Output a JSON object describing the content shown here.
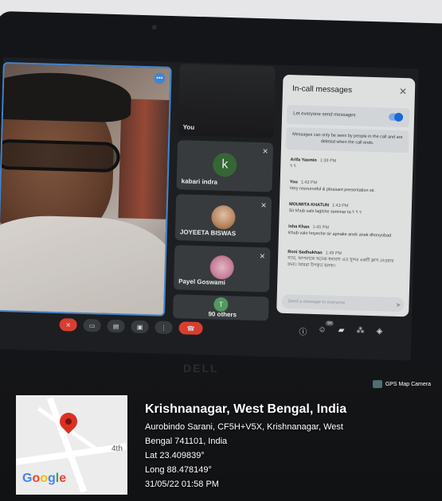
{
  "meeting": {
    "chat_panel": {
      "title": "In-call messages",
      "let_everyone_label": "Let everyone send messages",
      "notice": "Messages can only be seen by people in the call and are deleted when the call ends.",
      "input_placeholder": "Send a message to everyone",
      "messages": [
        {
          "sender": "Arifa Yasmin",
          "time": "1:39 PM",
          "text": "ঽ ঽ"
        },
        {
          "sender": "You",
          "time": "1:43 PM",
          "text": "Very resourceful & pleasant presentation sir."
        },
        {
          "sender": "MOUMITA KHATUN",
          "time": "1:43 PM",
          "text": "Sir khub valo laglche seminar ta ঽ ঽ ঽ"
        },
        {
          "sender": "Isha Khan",
          "time": "1:45 PM",
          "text": "Khub valo hoyeche sir apnake anek anek dhonyobad"
        },
        {
          "sender": "Roni Sadhukhan",
          "time": "1:49 PM",
          "text": "স্যার, আপনাকে অনেক ধন্যবাদ এত সুন্দর একটি ক্লাস নেওয়ার জন্য। আমরা উপকৃত হলাম।"
        }
      ]
    },
    "participants": [
      {
        "name": "You",
        "initial": ""
      },
      {
        "name": "kabari indra",
        "initial": "k"
      },
      {
        "name": "JOYEETA BISWAS",
        "initial": ""
      },
      {
        "name": "Payel Goswami",
        "initial": ""
      },
      {
        "name": "90 others",
        "initial": "T"
      }
    ],
    "people_count_badge": "94"
  },
  "laptop_brand": "DELL",
  "gps": {
    "app_label": "GPS Map Camera",
    "city": "Krishnanagar, West Bengal, India",
    "address_line1": "Aurobindo Sarani, CF5H+V5X, Krishnanagar, West",
    "address_line2": "Bengal 741101, India",
    "lat": "Lat 23.409839°",
    "long": "Long 88.478149°",
    "datetime": "31/05/22 01:58 PM",
    "map_street_label": "4th",
    "map_logo": "Google"
  }
}
